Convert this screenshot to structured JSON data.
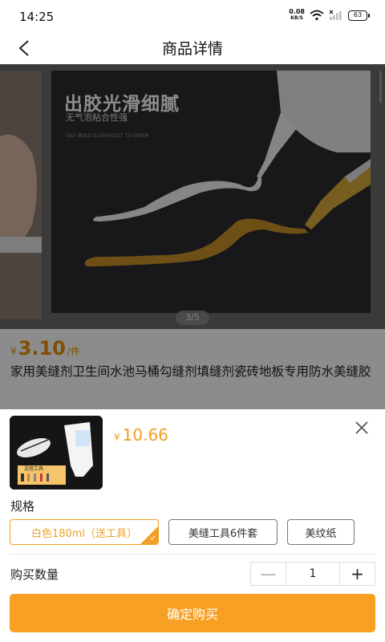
{
  "status_bar": {
    "time": "14:25",
    "net_speed_value": "0.08",
    "net_speed_unit": "KB/S",
    "battery": "63"
  },
  "nav": {
    "title": "商品详情",
    "back_icon": "chevron-left-icon"
  },
  "gallery": {
    "headline": "出胶光滑细腻",
    "subheadline": "无气泡粘合性强",
    "tiny_text": "OILY MOLD IS DIFFICULT TO ENTER",
    "page_indicator": "3/5",
    "current_page": 3,
    "total_pages": 5
  },
  "product": {
    "currency": "¥",
    "price": "3.10",
    "unit": "/件",
    "title": "家用美缝剂卫生间水池马桶勾缝剂填缝剂瓷砖地板专用防水美缝胶"
  },
  "sheet": {
    "currency": "¥",
    "price": "10.66",
    "close_icon": "close-icon",
    "thumb_label": "送搭工具",
    "spec_label": "规格",
    "spec_options": [
      {
        "label": "白色180ml（送工具）",
        "selected": true
      },
      {
        "label": "美缝工具6件套",
        "selected": false
      },
      {
        "label": "美纹纸",
        "selected": false
      }
    ],
    "quantity_label": "购买数量",
    "quantity": "1",
    "minus_label": "—",
    "plus_label": "+",
    "confirm_label": "确定购买"
  },
  "colors": {
    "accent": "#f0a024",
    "button": "#f8a022",
    "price_orange": "#e8900a"
  }
}
